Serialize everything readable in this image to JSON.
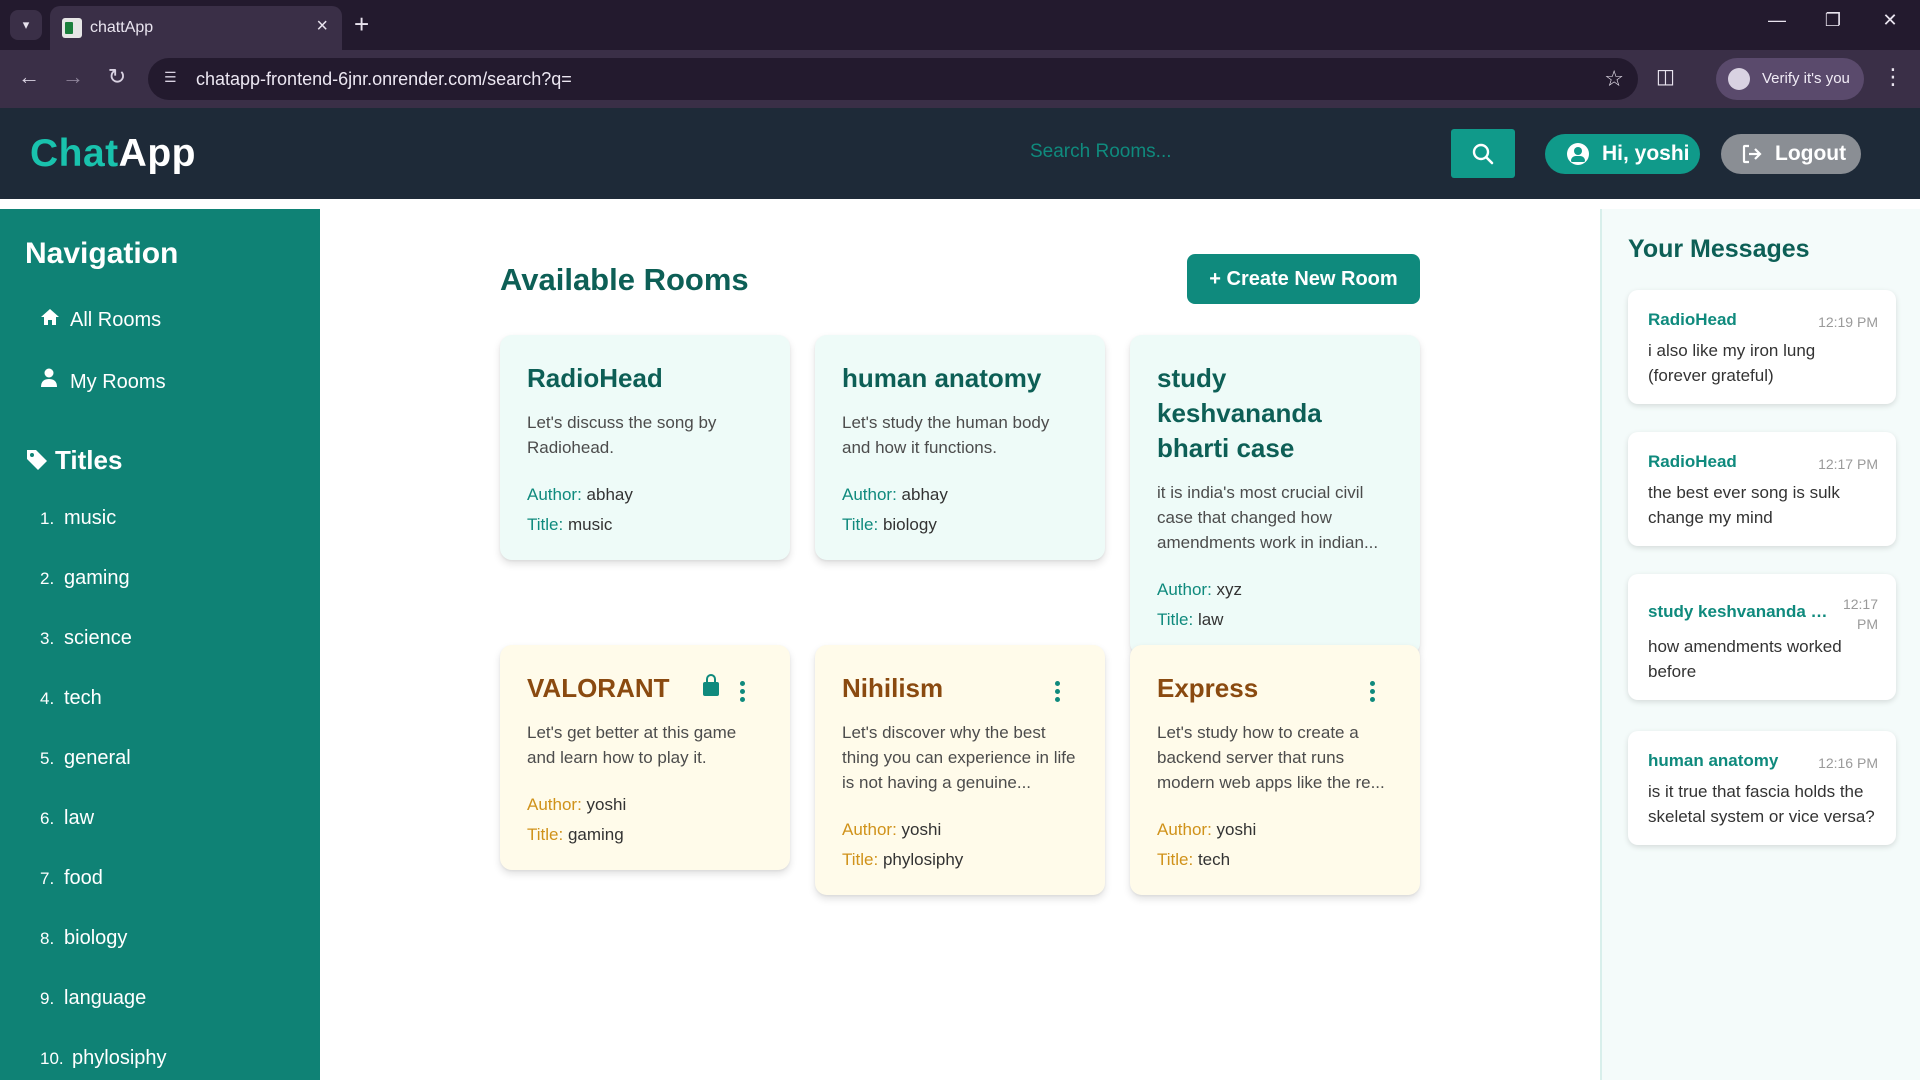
{
  "browser": {
    "tab_title": "chattApp",
    "url": "chatapp-frontend-6jnr.onrender.com/search?q=",
    "verify_label": "Verify it's you"
  },
  "header": {
    "logo_part1": "Chat",
    "logo_part2": "App",
    "search_placeholder": "Search Rooms...",
    "greeting": "Hi, yoshi",
    "logout_label": "Logout"
  },
  "sidebar": {
    "nav_heading": "Navigation",
    "nav_items": [
      {
        "label": "All Rooms",
        "icon": "home-icon"
      },
      {
        "label": "My Rooms",
        "icon": "user-icon"
      }
    ],
    "titles_heading": "Titles",
    "titles": [
      {
        "num": "1.",
        "label": "music"
      },
      {
        "num": "2.",
        "label": "gaming"
      },
      {
        "num": "3.",
        "label": "science"
      },
      {
        "num": "4.",
        "label": "tech"
      },
      {
        "num": "5.",
        "label": "general"
      },
      {
        "num": "6.",
        "label": "law"
      },
      {
        "num": "7.",
        "label": "food"
      },
      {
        "num": "8.",
        "label": "biology"
      },
      {
        "num": "9.",
        "label": "language"
      },
      {
        "num": "10.",
        "label": "phylosiphy"
      }
    ]
  },
  "main": {
    "title": "Available Rooms",
    "create_label": "+ Create New Room",
    "author_label": "Author:",
    "title_label": "Title:",
    "rooms": [
      {
        "name": "RadioHead",
        "desc": "Let's discuss the song by Radiohead.",
        "author": "abhay",
        "title": "music"
      },
      {
        "name": "human anatomy",
        "desc": "Let's study the human body and how it functions.",
        "author": "abhay",
        "title": "biology"
      },
      {
        "name": "study keshvananda bharti case",
        "desc": "it is india's most crucial civil case that changed how amendments work in indian...",
        "author": "xyz",
        "title": "law"
      },
      {
        "name": "VALORANT",
        "desc": "Let's get better at this game and learn how to play it.",
        "author": "yoshi",
        "title": "gaming"
      },
      {
        "name": "Nihilism",
        "desc": "Let's discover why the best thing you can experience in life is not having a genuine...",
        "author": "yoshi",
        "title": "phylosiphy"
      },
      {
        "name": "Express",
        "desc": "Let's study how to create a backend server that runs modern web apps like the re...",
        "author": "yoshi",
        "title": "tech"
      }
    ]
  },
  "messages": {
    "heading": "Your Messages",
    "items": [
      {
        "room": "RadioHead",
        "time": "12:19 PM",
        "text": "i also like my iron lung (forever grateful)"
      },
      {
        "room": "RadioHead",
        "time": "12:17 PM",
        "text": "the best ever song is sulk change my mind"
      },
      {
        "room": "study keshvananda b...",
        "time": "12:17 PM",
        "text": "how amendments worked before"
      },
      {
        "room": "human anatomy",
        "time": "12:16 PM",
        "text": "is it true that fascia holds the skeletal system or vice versa?"
      }
    ]
  }
}
